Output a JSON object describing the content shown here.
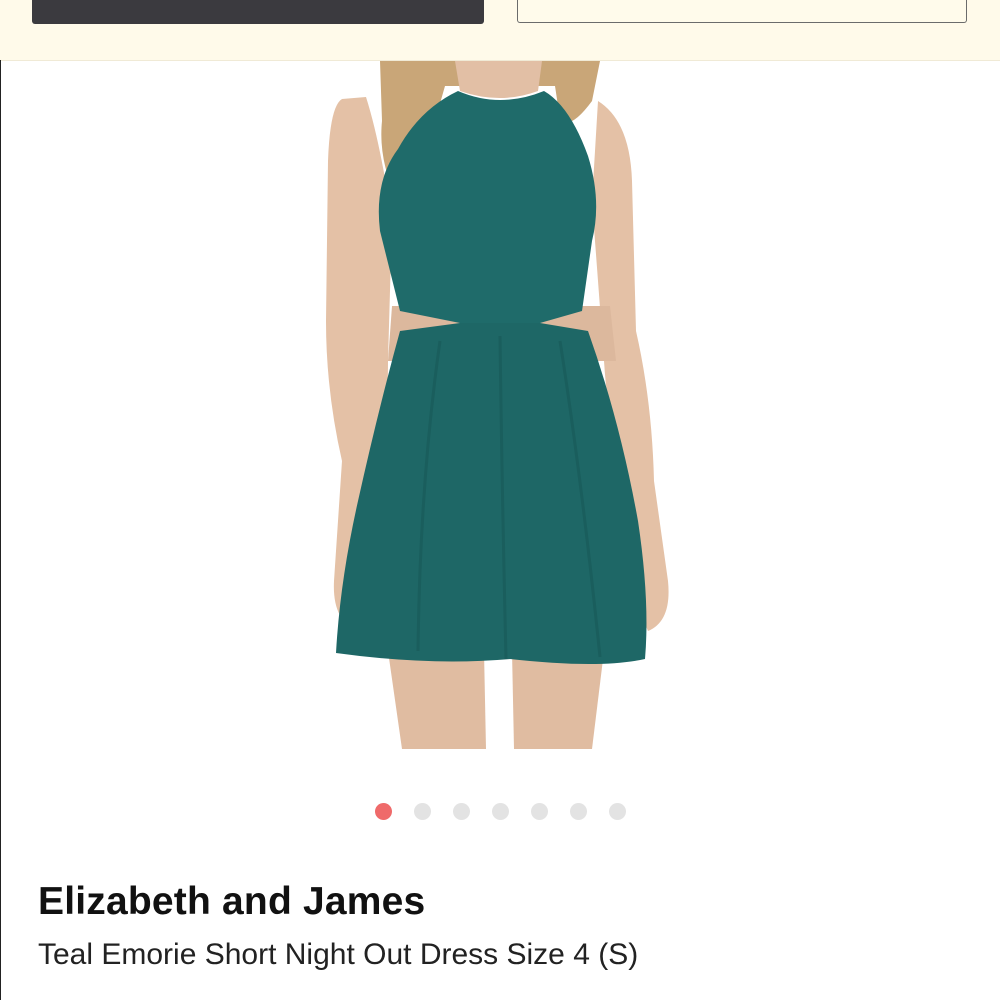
{
  "header": {
    "primary_button_color": "#3b3a3f",
    "background_color": "#fffaea"
  },
  "product": {
    "brand": "Elizabeth and James",
    "title": "Teal Emorie Short Night Out Dress Size 4 (S)",
    "image": {
      "subject": "woman wearing teal sleeveless cutout skater dress",
      "dress_color": "#1f6b6a"
    }
  },
  "gallery": {
    "total_images": 7,
    "active_index": 0,
    "active_dot_color": "#ef6a6a",
    "inactive_dot_color": "#e3e3e3"
  }
}
